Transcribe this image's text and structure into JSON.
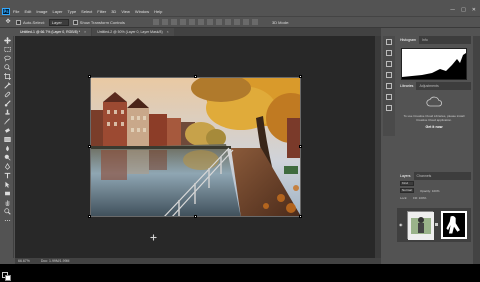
{
  "menubar": {
    "logo": "Ps",
    "items": [
      "File",
      "Edit",
      "Image",
      "Layer",
      "Type",
      "Select",
      "Filter",
      "3D",
      "View",
      "Window",
      "Help"
    ],
    "window_controls": [
      "—",
      "□",
      "✕"
    ]
  },
  "options": {
    "auto_select_label": "Auto-Select:",
    "auto_select_value": "Layer",
    "show_transform_label": "Show Transform Controls",
    "mode_3d_label": "3D Mode:"
  },
  "tabs": [
    {
      "label": "Untitled-1 @ 66.7% (Layer 0, RGB/8) *",
      "active": true
    },
    {
      "label": "Untitled-2 @ 50% (Layer 0, Layer Mask/8)",
      "active": false
    }
  ],
  "status": {
    "zoom": "66.67%",
    "doc": "Doc: 1.99M/1.99M"
  },
  "histogram_panel": {
    "tabs": [
      "Histogram",
      "Info"
    ],
    "active_tab": "Histogram"
  },
  "libraries_panel": {
    "tabs": [
      "Libraries",
      "Adjustments"
    ],
    "active_tab": "Libraries",
    "message": "To use Creative Cloud Libraries, please install Creative Cloud application.",
    "link": "Get it now"
  },
  "layers_panel": {
    "tabs": [
      "Layers",
      "Channels"
    ],
    "active_tab": "Layers",
    "kind_value": "Kind",
    "blend_mode": "Normal",
    "opacity_label": "Opacity: 100%",
    "lock_label": "Lock:",
    "fill_label": "Fill: 100%"
  },
  "colors": {
    "ui_bg": "#535353",
    "canvas_bg": "#282828",
    "accent": "#31a8ff"
  }
}
